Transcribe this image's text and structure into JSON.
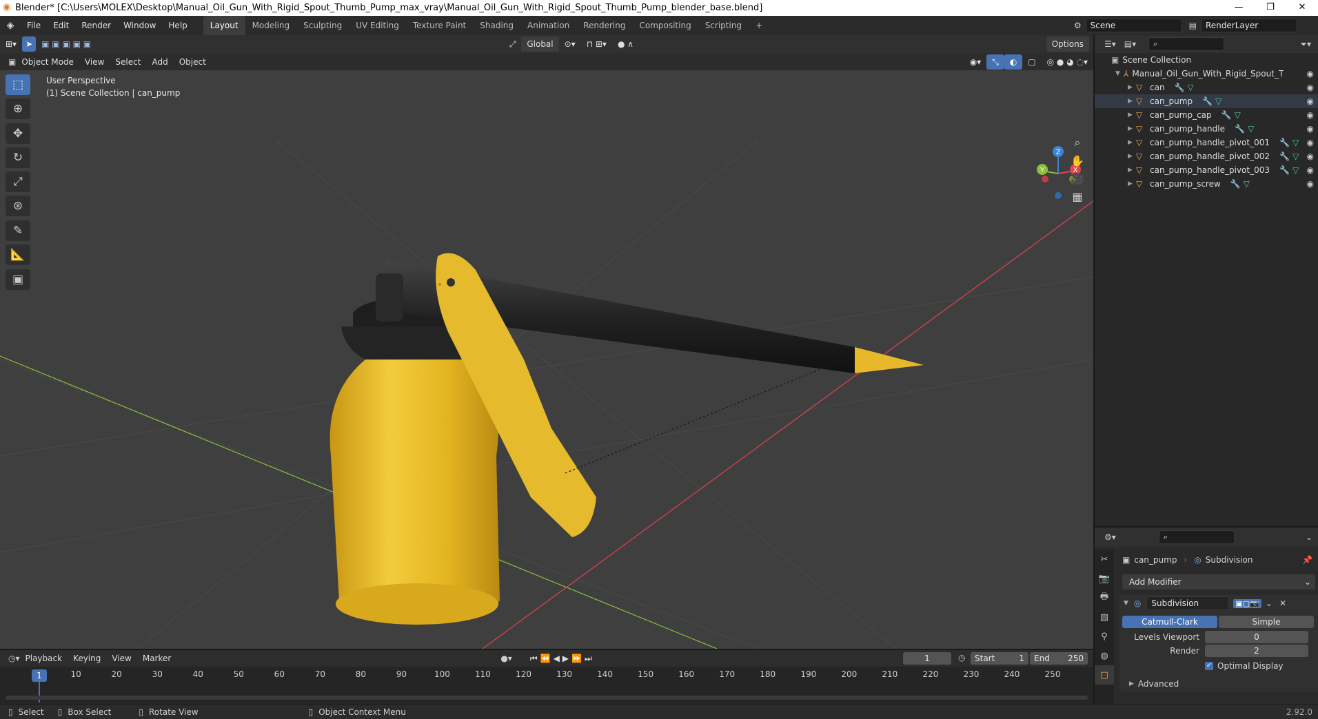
{
  "window": {
    "title": "Blender* [C:\\Users\\MOLEX\\Desktop\\Manual_Oil_Gun_With_Rigid_Spout_Thumb_Pump_max_vray\\Manual_Oil_Gun_With_Rigid_Spout_Thumb_Pump_blender_base.blend]",
    "controls": [
      "—",
      "❐",
      "✕"
    ]
  },
  "menus": [
    "File",
    "Edit",
    "Render",
    "Window",
    "Help"
  ],
  "workspaces": [
    "Layout",
    "Modeling",
    "Sculpting",
    "UV Editing",
    "Texture Paint",
    "Shading",
    "Animation",
    "Rendering",
    "Compositing",
    "Scripting"
  ],
  "active_workspace": "Layout",
  "scene": {
    "name": "Scene",
    "render_layer": "RenderLayer"
  },
  "viewport_header": {
    "transform_orientation": "Global",
    "options_label": "Options",
    "mode": "Object Mode",
    "menus": [
      "View",
      "Select",
      "Add",
      "Object"
    ]
  },
  "viewport": {
    "perspective": "User Perspective",
    "collection_info": "(1) Scene Collection | can_pump",
    "gizmo": {
      "x": "X",
      "y": "Y",
      "z": "Z"
    }
  },
  "outliner": {
    "root": "Scene Collection",
    "collection": "Manual_Oil_Gun_With_Rigid_Spout_Thumb_F",
    "objects": [
      "can",
      "can_pump",
      "can_pump_cap",
      "can_pump_handle",
      "can_pump_handle_pivot_001",
      "can_pump_handle_pivot_002",
      "can_pump_handle_pivot_003",
      "can_pump_screw"
    ],
    "selected": "can_pump"
  },
  "properties": {
    "object": "can_pump",
    "modifier_tab": "Subdivision",
    "add_modifier": "Add Modifier",
    "modifier_name": "Subdivision",
    "catmull": "Catmull-Clark",
    "simple": "Simple",
    "levels_viewport_label": "Levels Viewport",
    "levels_viewport": "0",
    "render_label": "Render",
    "render": "2",
    "optimal_display": "Optimal Display",
    "optimal_display_checked": true,
    "advanced": "Advanced",
    "version": "2.92.0"
  },
  "timeline": {
    "menus": [
      "Playback",
      "Keying",
      "View",
      "Marker"
    ],
    "current_frame": "1",
    "start_label": "Start",
    "start": "1",
    "end_label": "End",
    "end": "250",
    "ticks": [
      "1",
      "10",
      "20",
      "30",
      "40",
      "50",
      "60",
      "70",
      "80",
      "90",
      "100",
      "110",
      "120",
      "130",
      "140",
      "150",
      "160",
      "170",
      "180",
      "190",
      "200",
      "210",
      "220",
      "230",
      "240",
      "250"
    ]
  },
  "statusbar": {
    "select": "Select",
    "box_select": "Box Select",
    "rotate_view": "Rotate View",
    "context_menu": "Object Context Menu"
  },
  "colors": {
    "accent": "#4772b3",
    "x_axis": "#e2434f",
    "y_axis": "#8bbf3c",
    "z_axis": "#3b84d8",
    "can_yellow": "#e8b82a"
  }
}
